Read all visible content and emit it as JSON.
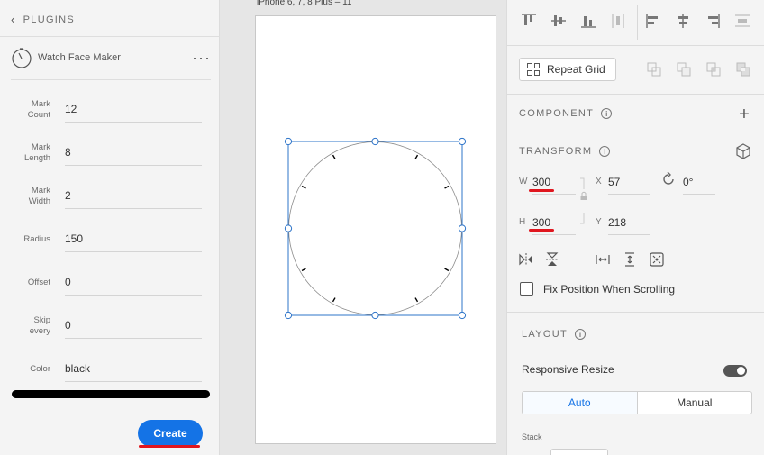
{
  "plugins_panel": {
    "header": "PLUGINS",
    "plugin_name": "Watch Face Maker",
    "fields": [
      {
        "label": "Mark Count",
        "value": "12"
      },
      {
        "label": "Mark Length",
        "value": "8"
      },
      {
        "label": "Mark Width",
        "value": "2"
      },
      {
        "label": "Radius",
        "value": "150"
      },
      {
        "label": "Offset",
        "value": "0"
      },
      {
        "label": "Skip every",
        "value": "0"
      },
      {
        "label": "Color",
        "value": "black"
      }
    ],
    "create_label": "Create"
  },
  "canvas": {
    "artboard_title": "iPhone 6, 7, 8 Plus – 11",
    "mark_count": 12
  },
  "inspector": {
    "repeat_grid_label": "Repeat Grid",
    "component_title": "COMPONENT",
    "transform_title": "TRANSFORM",
    "w_label": "W",
    "w_value": "300",
    "h_label": "H",
    "h_value": "300",
    "x_label": "X",
    "x_value": "57",
    "y_label": "Y",
    "y_value": "218",
    "rotation_value": "0°",
    "fix_position_label": "Fix Position When Scrolling",
    "layout_title": "LAYOUT",
    "responsive_resize_label": "Responsive Resize",
    "auto_label": "Auto",
    "manual_label": "Manual",
    "stack_label": "Stack"
  },
  "colors": {
    "accent": "#1473e6",
    "annotation": "#e0161e",
    "selection": "#2d74c9"
  }
}
